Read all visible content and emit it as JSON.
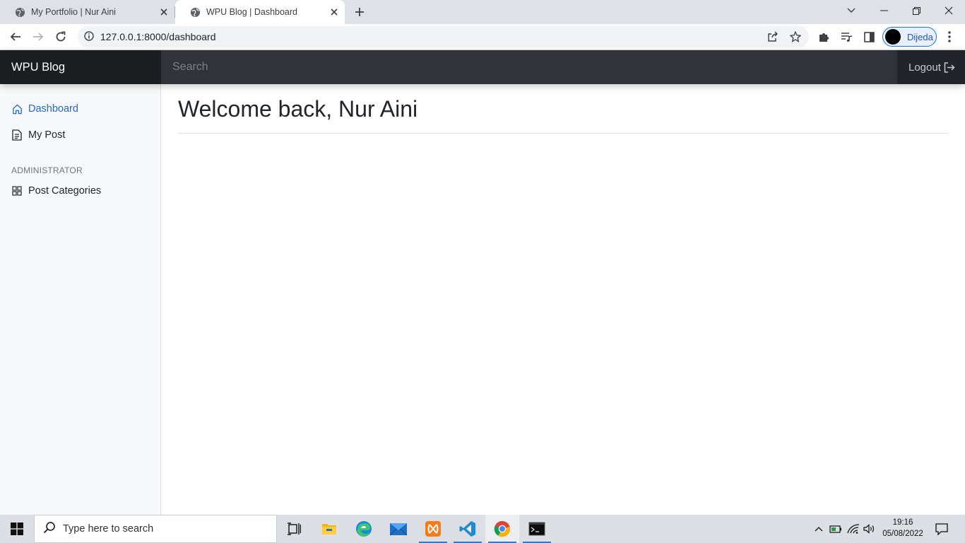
{
  "browser": {
    "tabs": [
      {
        "title": "My Portfolio | Nur Aini",
        "active": false
      },
      {
        "title": "WPU Blog | Dashboard",
        "active": true
      }
    ],
    "url": "127.0.0.1:8000/dashboard",
    "profile_name": "Dijeda"
  },
  "navbar": {
    "brand": "WPU Blog",
    "search_placeholder": "Search",
    "logout_label": "Logout"
  },
  "sidebar": {
    "items": [
      {
        "label": "Dashboard",
        "icon": "home-icon",
        "active": true
      },
      {
        "label": "My Post",
        "icon": "file-text-icon",
        "active": false
      }
    ],
    "admin_heading": "ADMINISTRATOR",
    "admin_items": [
      {
        "label": "Post Categories",
        "icon": "grid-icon",
        "active": false
      }
    ]
  },
  "main": {
    "title": "Welcome back, Nur Aini"
  },
  "taskbar": {
    "search_placeholder": "Type here to search",
    "time": "19:16",
    "date": "05/08/2022",
    "apps": [
      "task-view",
      "file-explorer",
      "edge",
      "mail",
      "xampp",
      "vscode",
      "chrome",
      "terminal"
    ]
  },
  "colors": {
    "navbar": "#212529",
    "brand_bg": "#1b1e21",
    "search_bg": "#303438",
    "sidebar_bg": "#f8f9fa",
    "active_link": "#2467c4"
  }
}
